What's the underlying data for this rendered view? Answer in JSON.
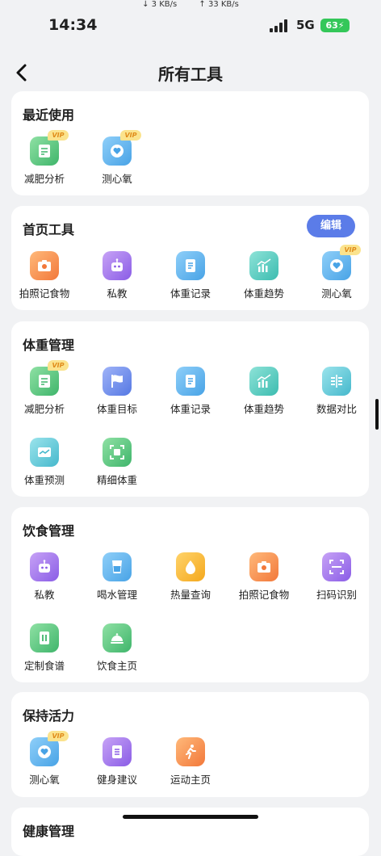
{
  "status": {
    "time": "14:34",
    "down": "↓ 3 KB/s",
    "up": "↑ 33 KB/s",
    "network": "5G",
    "battery": "63"
  },
  "nav": {
    "title": "所有工具"
  },
  "vip_badge": "VIP",
  "recent": {
    "title": "最近使用",
    "items": [
      {
        "label": "减肥分析",
        "icon": "report-icon"
      },
      {
        "label": "测心氧",
        "icon": "heart-oxygen-icon"
      }
    ]
  },
  "home_tools": {
    "title": "首页工具",
    "edit_label": "编辑",
    "items": [
      {
        "label": "拍照记食物",
        "icon": "camera-icon"
      },
      {
        "label": "私教",
        "icon": "robot-icon"
      },
      {
        "label": "体重记录",
        "icon": "notebook-icon"
      },
      {
        "label": "体重趋势",
        "icon": "trend-chart-icon"
      },
      {
        "label": "测心氧",
        "icon": "heart-oxygen-icon"
      }
    ]
  },
  "weight": {
    "title": "体重管理",
    "items": [
      {
        "label": "减肥分析",
        "icon": "report-icon"
      },
      {
        "label": "体重目标",
        "icon": "flag-icon"
      },
      {
        "label": "体重记录",
        "icon": "notebook-icon"
      },
      {
        "label": "体重趋势",
        "icon": "trend-chart-icon"
      },
      {
        "label": "数据对比",
        "icon": "compare-icon"
      },
      {
        "label": "体重预测",
        "icon": "predict-icon"
      },
      {
        "label": "精细体重",
        "icon": "scan-frame-icon"
      }
    ]
  },
  "diet": {
    "title": "饮食管理",
    "items": [
      {
        "label": "私教",
        "icon": "robot-icon"
      },
      {
        "label": "喝水管理",
        "icon": "water-cup-icon"
      },
      {
        "label": "热量查询",
        "icon": "flame-drop-icon"
      },
      {
        "label": "拍照记食物",
        "icon": "camera-icon"
      },
      {
        "label": "扫码识别",
        "icon": "scan-code-icon"
      },
      {
        "label": "定制食谱",
        "icon": "recipe-icon"
      },
      {
        "label": "饮食主页",
        "icon": "food-cloche-icon"
      }
    ]
  },
  "vitality": {
    "title": "保持活力",
    "items": [
      {
        "label": "测心氧",
        "icon": "heart-oxygen-icon"
      },
      {
        "label": "健身建议",
        "icon": "fitness-doc-icon"
      },
      {
        "label": "运动主页",
        "icon": "running-icon"
      }
    ]
  },
  "health": {
    "title": "健康管理"
  }
}
